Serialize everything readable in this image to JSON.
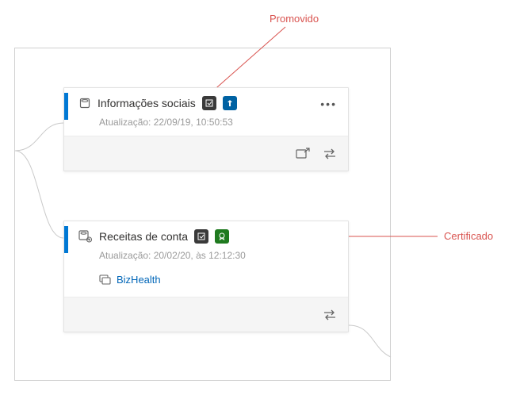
{
  "callouts": {
    "promoted": "Promovido",
    "certified": "Certificado"
  },
  "cards": [
    {
      "title": "Informações sociais",
      "subtitle": "Atualização: 22/09/19, 10:50:53",
      "badges": [
        "sensitivity",
        "promoted"
      ],
      "footer_icons": [
        "share",
        "swap"
      ],
      "show_more": true
    },
    {
      "title": "Receitas de conta",
      "subtitle": "Atualização: 20/02/20, às 12:12:30",
      "badges": [
        "sensitivity",
        "certified"
      ],
      "link_label": "BizHealth",
      "footer_icons": [
        "swap"
      ],
      "show_more": false
    }
  ],
  "colors": {
    "accent": "#0078d4",
    "callout": "#d9534f",
    "link": "#0066b8",
    "badge_dark": "#3a3a3a",
    "badge_blue": "#0062a3",
    "badge_green": "#1f7a1f"
  }
}
